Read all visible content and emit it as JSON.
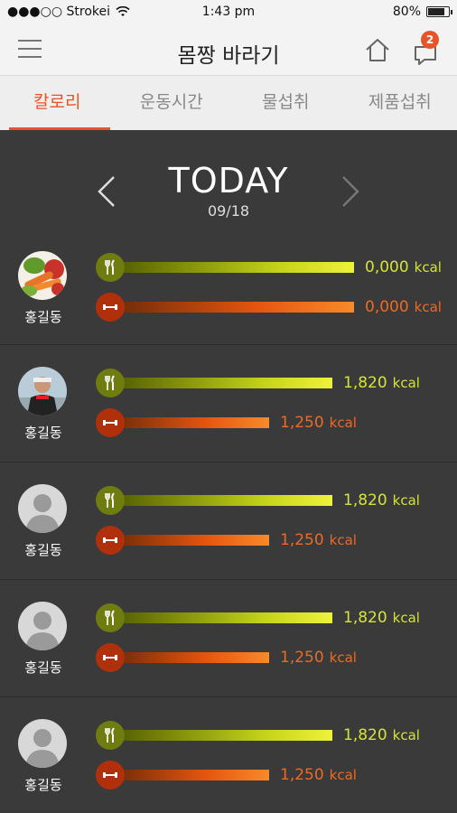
{
  "statusbar": {
    "carrier": "●●●○○ Strokei",
    "time": "1:43 pm",
    "battery": "80%",
    "battery_level": 0.8
  },
  "navbar": {
    "title": "몸짱 바라기",
    "badge_count": "2"
  },
  "tabs": [
    "칼로리",
    "운동시간",
    "물섭취",
    "제품섭취"
  ],
  "date": {
    "title": "TODAY",
    "sub": "09/18"
  },
  "unit": "kcal",
  "icons": {
    "food": "fork-knife-icon",
    "exercise": "dumbbell-icon"
  },
  "colors": {
    "accent": "#e8542a",
    "food": "#d4e33a",
    "exercise": "#ec6a24",
    "background": "#3a3a3a"
  },
  "rows": [
    {
      "name": "홍길동",
      "avatar": "vegetables-photo",
      "food_value": "0,000",
      "exercise_value": "0,000",
      "food_fraction": 1.0,
      "exercise_fraction": 1.0
    },
    {
      "name": "홍길동",
      "avatar": "athlete-photo",
      "food_value": "1,820",
      "exercise_value": "1,250",
      "food_fraction": 0.91,
      "exercise_fraction": 0.65
    },
    {
      "name": "홍길동",
      "avatar": "default-person",
      "food_value": "1,820",
      "exercise_value": "1,250",
      "food_fraction": 0.91,
      "exercise_fraction": 0.65
    },
    {
      "name": "홍길동",
      "avatar": "default-person",
      "food_value": "1,820",
      "exercise_value": "1,250",
      "food_fraction": 0.91,
      "exercise_fraction": 0.65
    },
    {
      "name": "홍길동",
      "avatar": "default-person",
      "food_value": "1,820",
      "exercise_value": "1,250",
      "food_fraction": 0.91,
      "exercise_fraction": 0.65
    }
  ]
}
